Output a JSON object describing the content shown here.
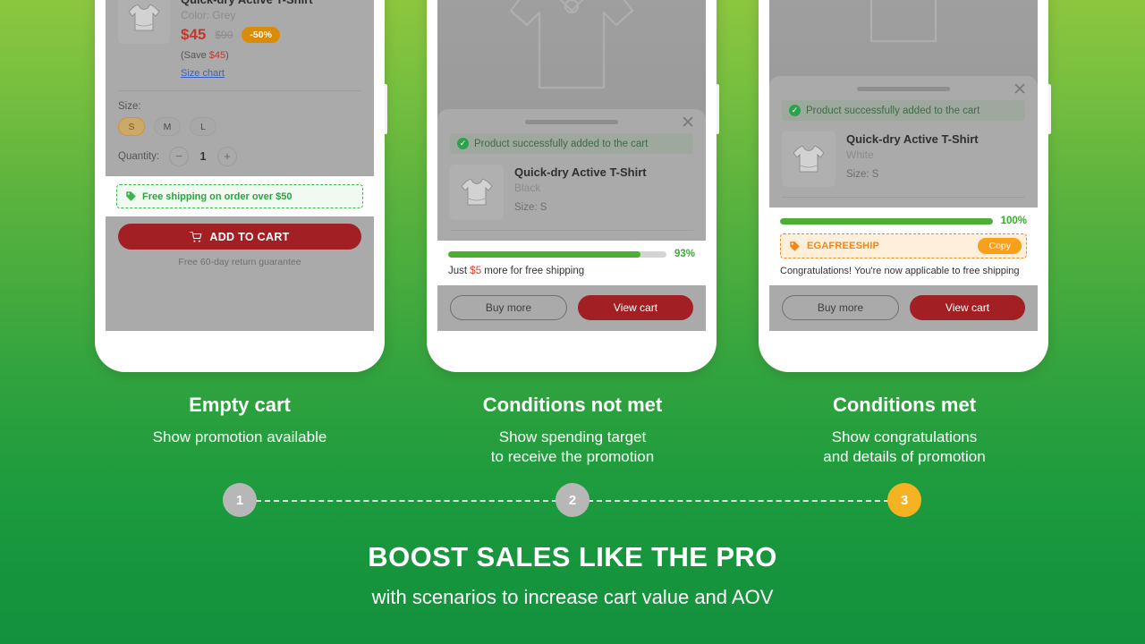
{
  "product": {
    "name": "Quick-dry Active T-Shirt",
    "color_grey": "Color: Grey",
    "color_black": "Black",
    "color_white": "White",
    "price_now": "$45",
    "price_old": "$90",
    "discount_badge": "-50%",
    "save_prefix": "(Save ",
    "save_amount": "$45",
    "save_suffix": ")",
    "size_chart_link": "Size chart",
    "size_label": "Size:",
    "size_options": [
      "S",
      "M",
      "L"
    ],
    "size_selected": "S",
    "size_value_line": "Size: S",
    "quantity_label": "Quantity:",
    "quantity_value": "1",
    "minus": "−",
    "plus": "+"
  },
  "phone1": {
    "promo_text": "Free shipping on order over $50",
    "cta_label": "ADD TO CART",
    "guarantee": "Free 60-day return guarantee"
  },
  "phone2": {
    "success_text": "Product successfully added to the cart",
    "percent": "93%",
    "progress_value": 88,
    "note_prefix": "Just ",
    "note_amount": "$5",
    "note_suffix": " more for free shipping",
    "buy_more": "Buy more",
    "view_cart": "View cart"
  },
  "phone3": {
    "success_text": "Product successfully added to the cart",
    "percent": "100%",
    "progress_value": 100,
    "coupon_code": "EGAFREESHIP",
    "copy_label": "Copy",
    "congrats": "Congratulations! You're now applicable to free shipping",
    "buy_more": "Buy more",
    "view_cart": "View cart"
  },
  "captions": [
    {
      "title": "Empty cart",
      "sub": "Show promotion available"
    },
    {
      "title": "Conditions not met",
      "sub_line1": "Show spending target",
      "sub_line2": "to receive the promotion"
    },
    {
      "title": "Conditions met",
      "sub_line1": "Show congratulations",
      "sub_line2": "and details of promotion"
    }
  ],
  "steps": [
    "1",
    "2",
    "3"
  ],
  "headline": {
    "main": "BOOST SALES LIKE THE PRO",
    "sub": "with scenarios to increase cart value and AOV"
  },
  "icons": {
    "close": "✕",
    "check": "✓",
    "tag": "tag-icon",
    "cart": "cart-icon"
  },
  "colors": {
    "brand_green": "#2aa342",
    "cta_red": "#a21f23",
    "amber": "#f5b324",
    "orange": "#f0871a"
  }
}
